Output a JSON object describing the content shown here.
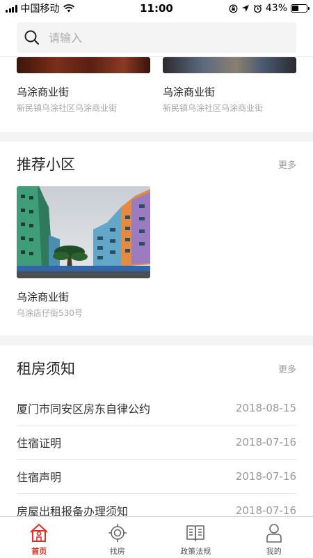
{
  "status_bar": {
    "carrier": "中国移动",
    "time": "11:00",
    "battery_percent": "43%",
    "battery_level": 0.43
  },
  "search": {
    "placeholder": "请输入"
  },
  "top_cards": [
    {
      "title": "乌涂商业街",
      "address": "新民镇乌涂社区乌涂商业街"
    },
    {
      "title": "乌涂商业街",
      "address": "新民镇乌涂社区乌涂商业街"
    }
  ],
  "recommended": {
    "title": "推荐小区",
    "more": "更多",
    "items": [
      {
        "title": "乌涂商业街",
        "address": "乌涂店仔街530号"
      }
    ]
  },
  "rental_notice": {
    "title": "租房须知",
    "more": "更多",
    "items": [
      {
        "title": "厦门市同安区房东自律公约",
        "date": "2018-08-15"
      },
      {
        "title": "住宿证明",
        "date": "2018-07-16"
      },
      {
        "title": "住宿声明",
        "date": "2018-07-16"
      },
      {
        "title": "房屋出租报备办理须知",
        "date": "2018-07-16"
      }
    ]
  },
  "tab_bar": {
    "accent_color": "#e02e24",
    "tabs": [
      {
        "label": "首页",
        "icon": "home-icon",
        "active": true
      },
      {
        "label": "找房",
        "icon": "target-icon",
        "active": false
      },
      {
        "label": "政策法规",
        "icon": "book-icon",
        "active": false
      },
      {
        "label": "我的",
        "icon": "user-icon",
        "active": false
      }
    ]
  }
}
